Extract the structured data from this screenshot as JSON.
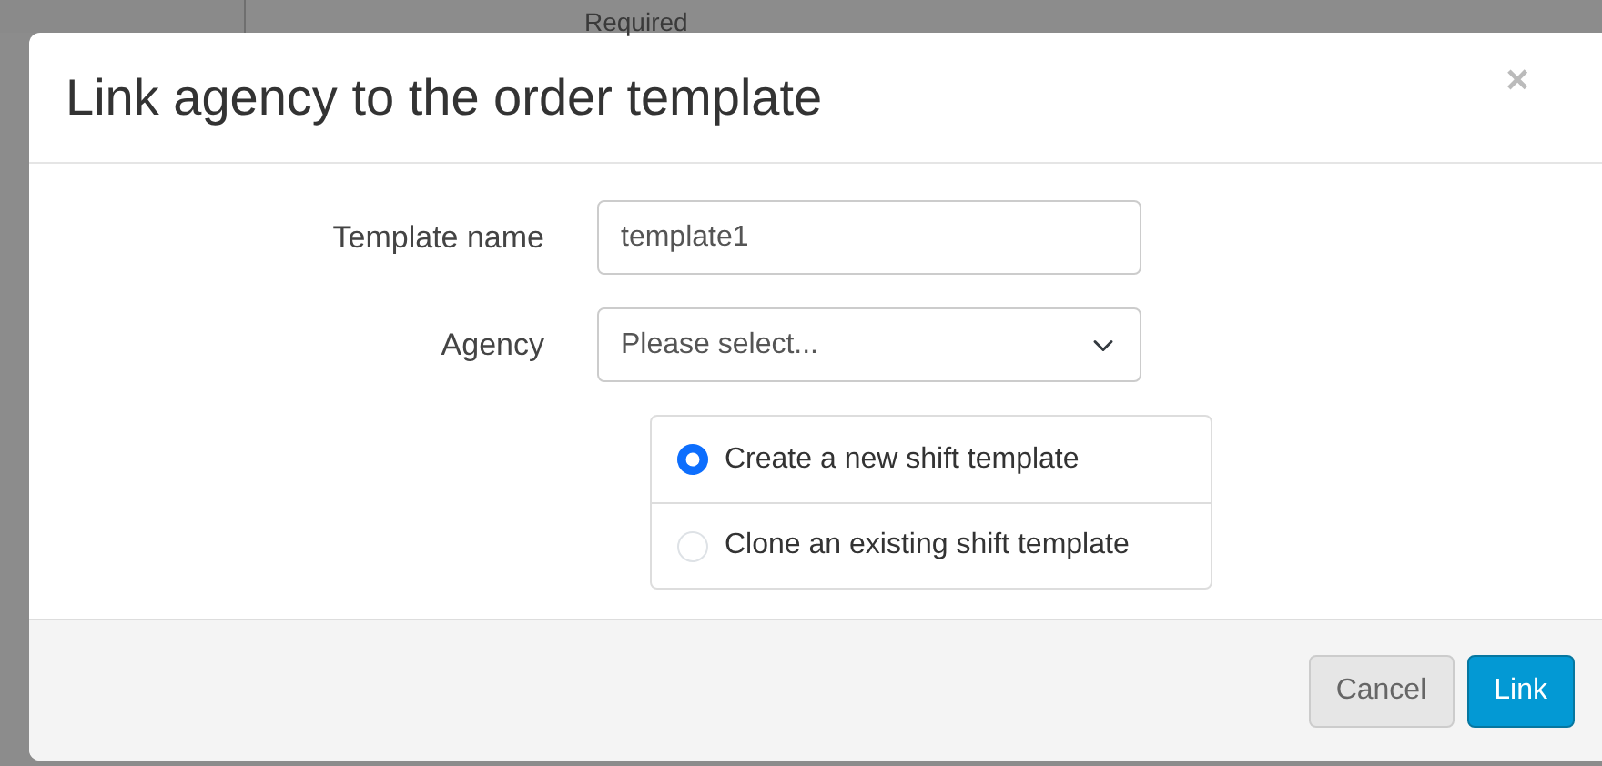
{
  "background": {
    "label": "Required"
  },
  "dialog": {
    "title": "Link agency to the order template",
    "close": "×"
  },
  "fields": [
    {
      "kind": "text",
      "label": "Template name",
      "value": "template1"
    },
    {
      "kind": "select",
      "label": "Agency",
      "placeholder": "Please select..."
    }
  ],
  "options": [
    {
      "label": "Create a new shift template",
      "selected": true
    },
    {
      "label": "Clone an existing shift template",
      "selected": false
    }
  ],
  "buttons": [
    {
      "kind": "secondary",
      "label": "Cancel"
    },
    {
      "kind": "primary",
      "label": "Link"
    }
  ]
}
